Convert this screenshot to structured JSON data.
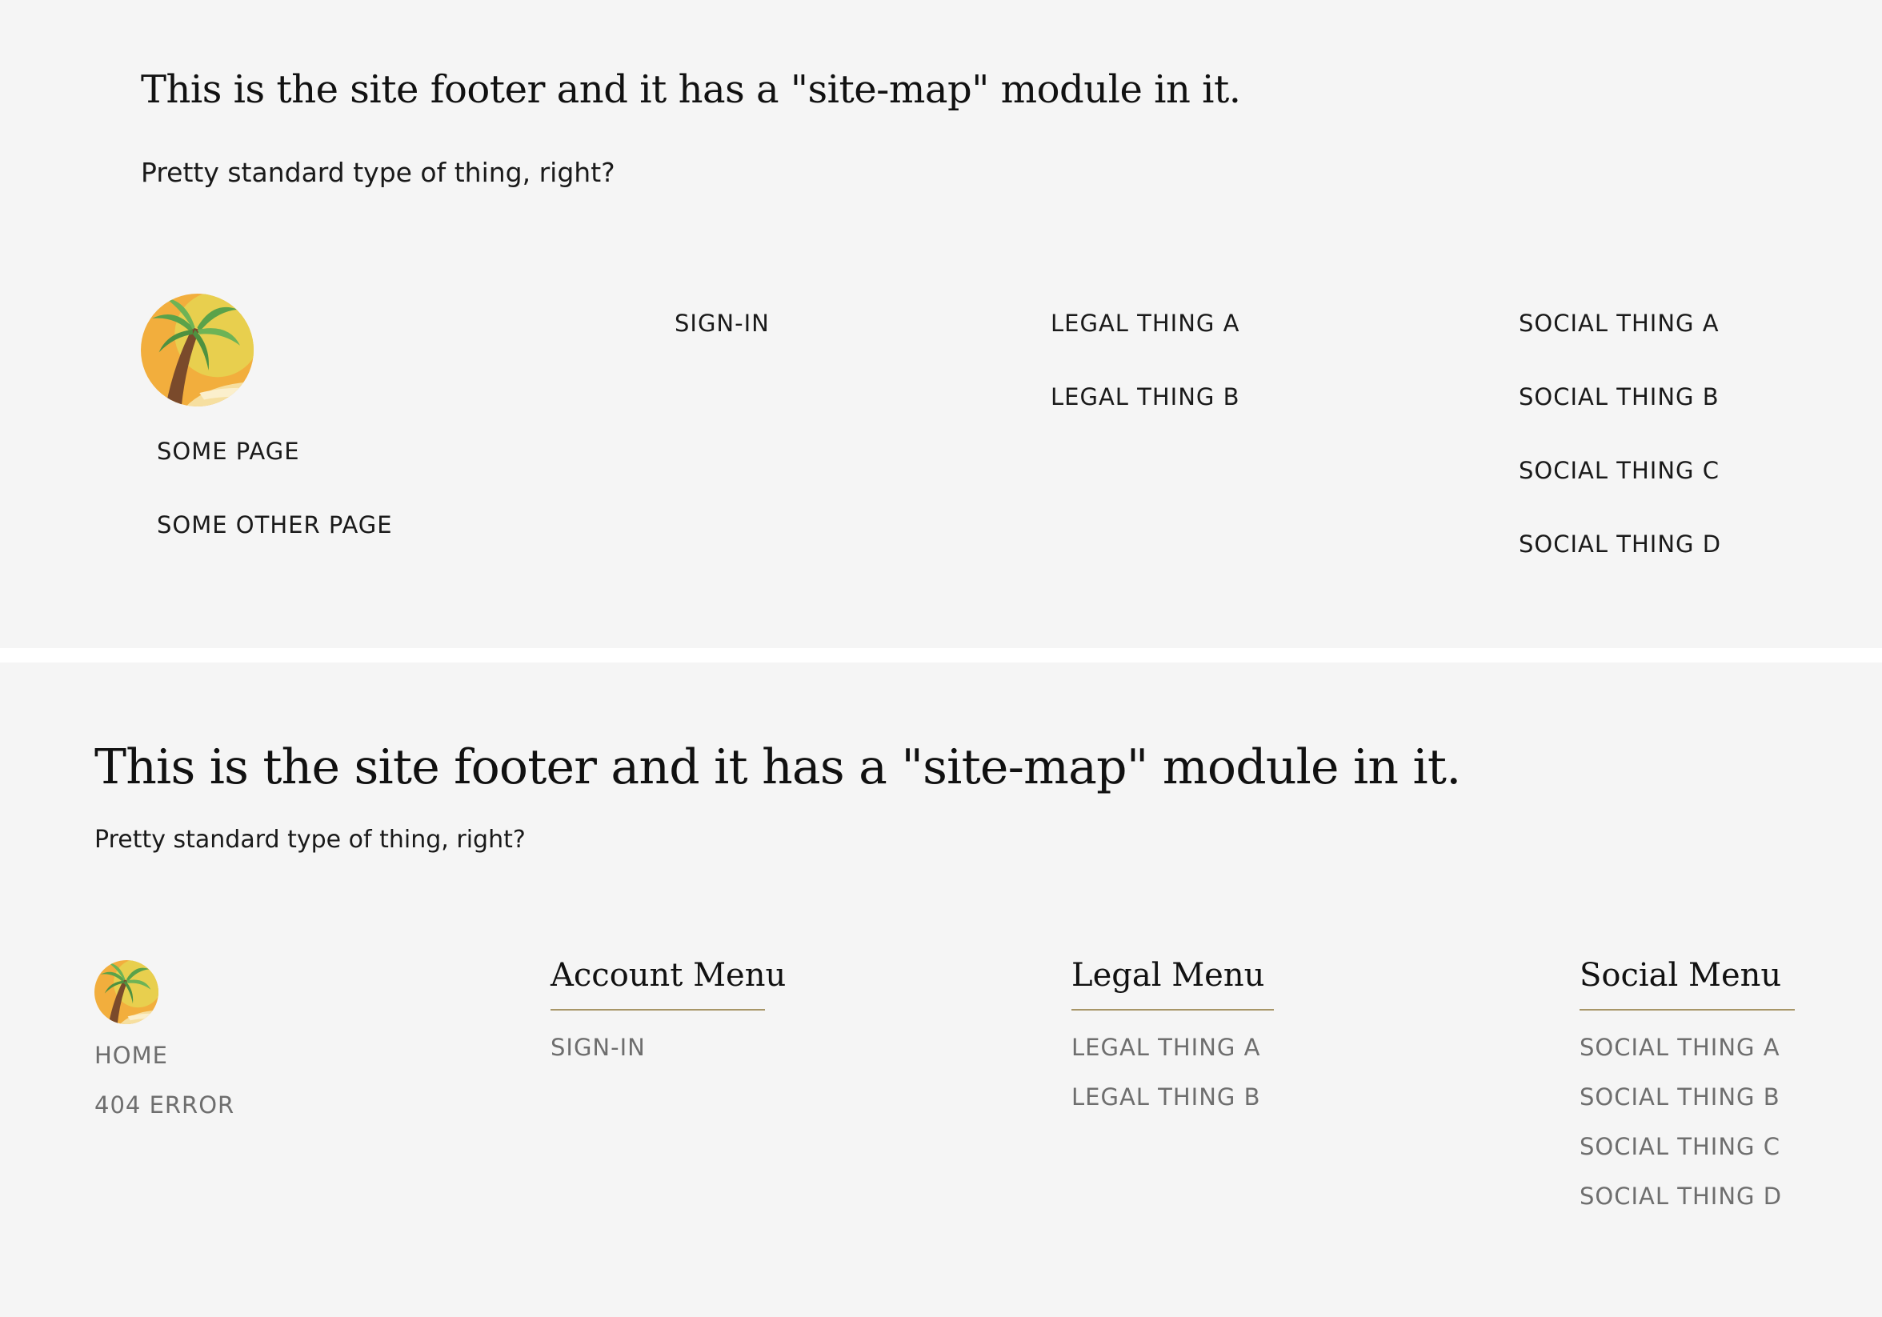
{
  "colors": {
    "panel_background": "#f5f5f5",
    "page_background": "#ffffff",
    "heading_text": "#111111",
    "link_text_top": "#1a1a1a",
    "link_text_bottom": "#6e6e6e",
    "menu_rule": "#a89668"
  },
  "top": {
    "heading": "This is the site footer and it has a \"site-map\" module in it.",
    "subheading": "Pretty standard type of thing, right?",
    "logo_icon": "palm-tree-logo-icon",
    "main_links": [
      "SOME PAGE",
      "SOME OTHER PAGE"
    ],
    "account_links": [
      "SIGN-IN"
    ],
    "legal_links": [
      "LEGAL THING A",
      "LEGAL THING B"
    ],
    "social_links": [
      "SOCIAL THING A",
      "SOCIAL THING B",
      "SOCIAL THING C",
      "SOCIAL THING D"
    ]
  },
  "bottom": {
    "heading": "This is the site footer and it has a \"site-map\" module in it.",
    "subheading": "Pretty standard type of thing, right?",
    "logo_icon": "palm-tree-logo-icon",
    "main_links": [
      "HOME",
      "404 ERROR"
    ],
    "account_menu": {
      "title": "Account Menu",
      "links": [
        "SIGN-IN"
      ]
    },
    "legal_menu": {
      "title": "Legal Menu",
      "links": [
        "LEGAL THING A",
        "LEGAL THING B"
      ]
    },
    "social_menu": {
      "title": "Social Menu",
      "links": [
        "SOCIAL THING A",
        "SOCIAL THING B",
        "SOCIAL THING C",
        "SOCIAL THING D"
      ]
    }
  }
}
